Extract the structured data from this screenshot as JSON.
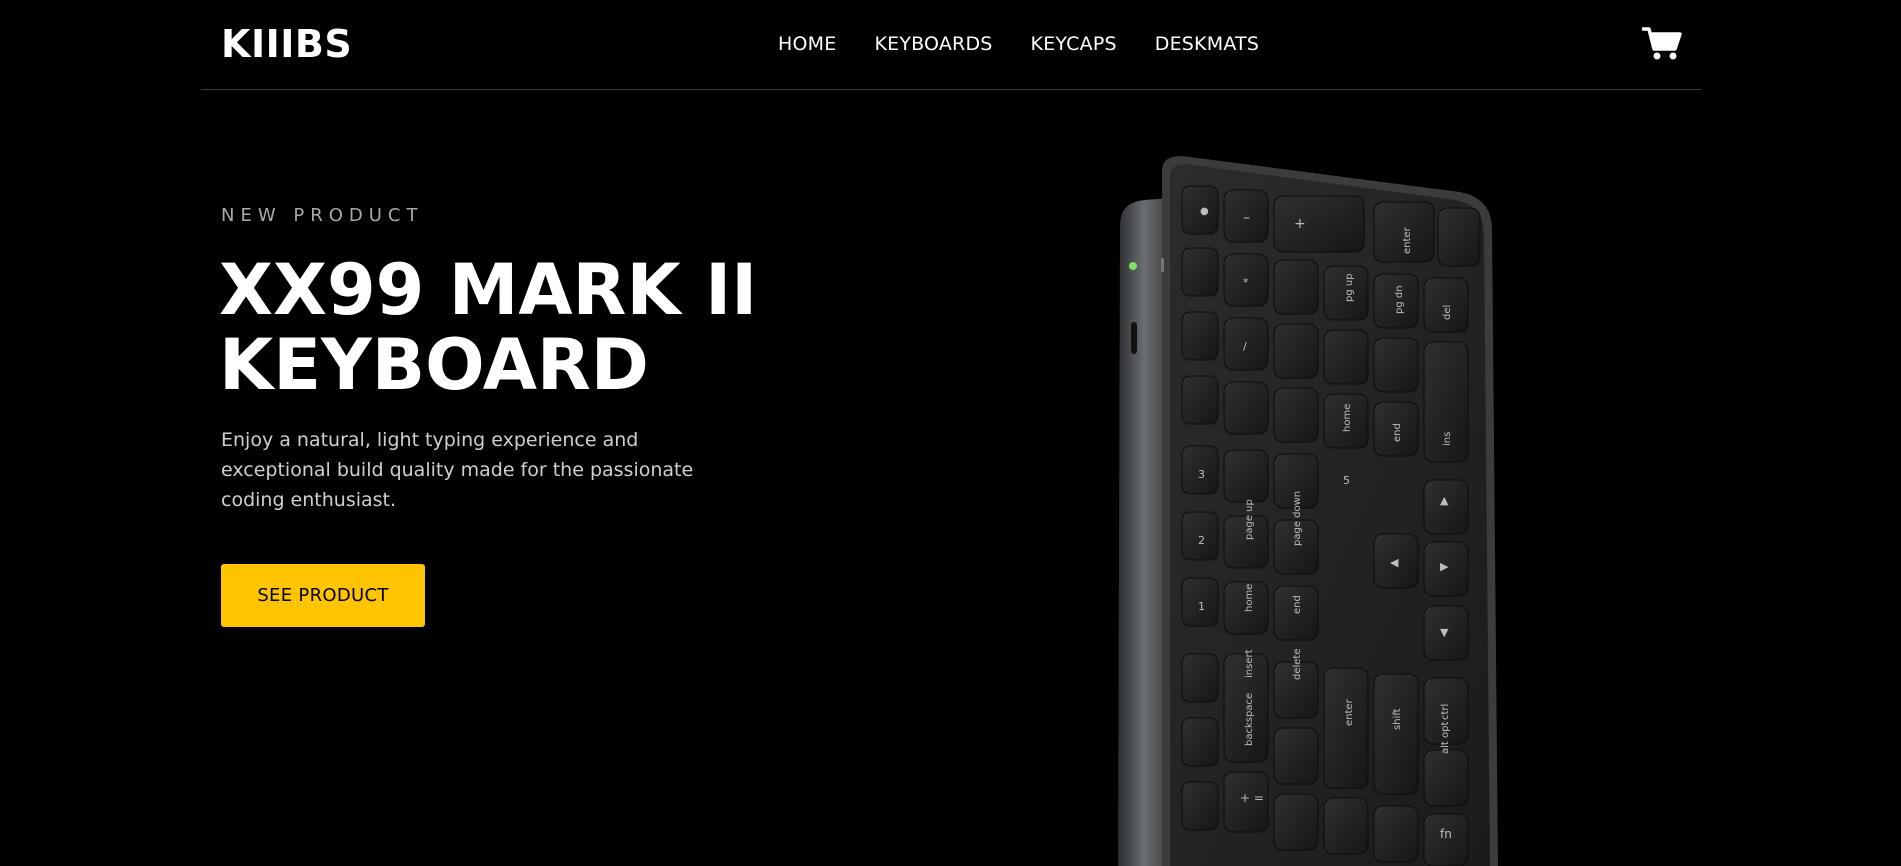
{
  "header": {
    "logo": "KIIIBS",
    "nav": [
      "HOME",
      "KEYBOARDS",
      "KEYCAPS",
      "DESKMATS"
    ],
    "cart_icon": "cart-icon"
  },
  "hero": {
    "eyebrow": "NEW PRODUCT",
    "title_line1": "XX99 MARK II",
    "title_line2": "KEYBOARD",
    "description": "Enjoy a natural, light typing experience and exceptional build quality made for the passionate coding enthusiast.",
    "cta_label": "SEE PRODUCT"
  },
  "colors": {
    "background": "#000000",
    "accent": "#ffc400",
    "text": "#ffffff",
    "muted": "#a8a8a8"
  }
}
